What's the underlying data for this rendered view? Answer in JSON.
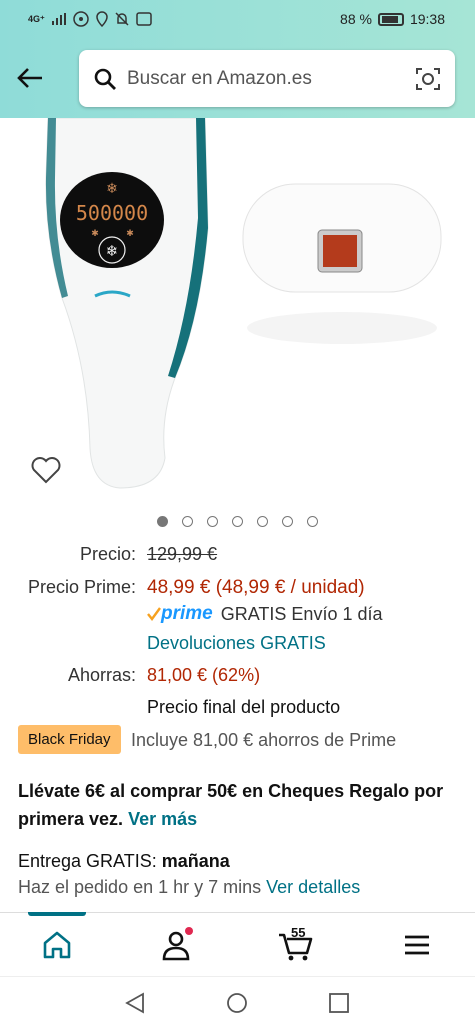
{
  "status_bar": {
    "network": "4G⁺",
    "battery": "88 %",
    "time": "19:38"
  },
  "search": {
    "placeholder": "Buscar en Amazon.es"
  },
  "product": {
    "display_value": "500000",
    "image_dots": {
      "count": 7,
      "active_index": 0
    }
  },
  "pricing": {
    "precio_label": "Precio:",
    "precio_old": "129,99 €",
    "prime_label": "Precio Prime:",
    "prime_price": "48,99 €",
    "prime_unit": "(48,99 € / unidad)",
    "prime_logo": "prime",
    "shipping": "GRATIS Envío 1 día",
    "returns": "Devoluciones GRATIS",
    "ahorras_label": "Ahorras:",
    "ahorras_value": "81,00 € (62%)",
    "final_note": "Precio final del producto"
  },
  "deal": {
    "badge": "Black Friday",
    "text": "Incluye 81,00 € ahorros de Prime"
  },
  "promo": {
    "text": "Llévate 6€ al comprar 50€ en Cheques Regalo por primera vez.",
    "link": "Ver más"
  },
  "delivery": {
    "label": "Entrega GRATIS:",
    "day": "mañana",
    "order_text": "Haz el pedido en 1 hr y 7 mins",
    "details_link": "Ver detalles"
  },
  "bottom_nav": {
    "cart_count": "55"
  },
  "colors": {
    "accent_teal": "#007185",
    "price_red": "#b12704",
    "header_gradient": "#8fdcd8",
    "badge": "#febd69"
  }
}
